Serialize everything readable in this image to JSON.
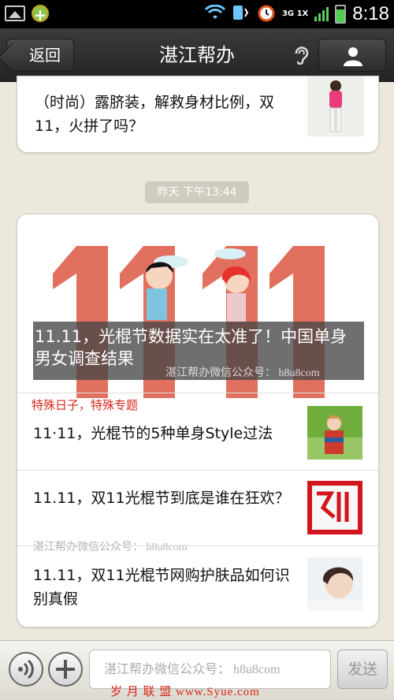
{
  "status_bar": {
    "network": "3G 1X",
    "time": "8:18"
  },
  "header": {
    "back_label": "返回",
    "title": "湛江帮办"
  },
  "messages": {
    "card1": {
      "text": "（时尚）露脐装，解救身材比例，双11，火拼了吗？"
    },
    "timestamp": "昨天 下午13:44",
    "card2": {
      "hero": {
        "caption": "11.11，光棍节数据实在太准了！中国单身男女调查结果",
        "watermark": "湛江帮办微信公众号： h8u8com"
      },
      "items": [
        {
          "tag": "特殊日子，特殊专题",
          "text": "11·11，光棍节的5种单身Style过法"
        },
        {
          "tag": "",
          "text": "11.11，双11光棍节到底是谁在狂欢？"
        },
        {
          "tag": "",
          "text": "11.11，双11光棍节网购护肤品如何识别真假"
        }
      ],
      "item_watermark": "湛江帮办微信公众号： h8u8com"
    }
  },
  "input_bar": {
    "placeholder": "湛江帮办微信公众号： h8u8com",
    "send_label": "发送"
  },
  "footer_watermark": "岁 月 联 盟  www.Syue.com",
  "colors": {
    "accent_red": "#d8281e",
    "header_bg": "#2c2c2c",
    "page_bg": "#ece9dc"
  }
}
